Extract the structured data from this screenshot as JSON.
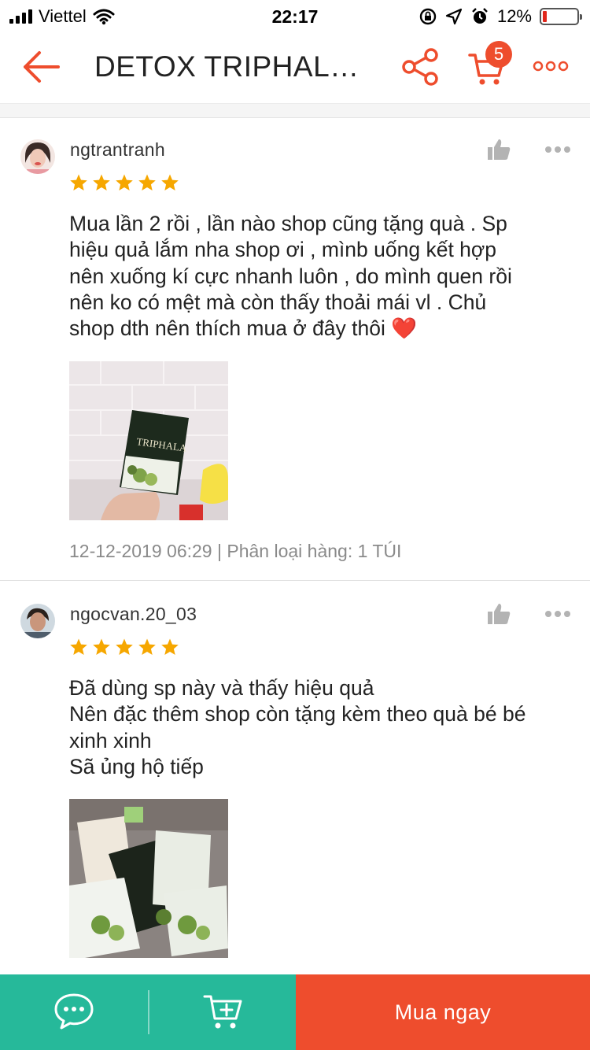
{
  "status_bar": {
    "carrier": "Viettel",
    "time": "22:17",
    "battery": "12%",
    "battery_level": 0.12
  },
  "nav": {
    "title": "DETOX TRIPHAL…",
    "cart_count": "5"
  },
  "reviews": [
    {
      "username": "ngtrantranh",
      "rating": 5,
      "text_lines": [
        "Mua lần 2 rồi , lần nào shop cũng tặng quà . Sp",
        "hiệu quả lắm nha shop ơi , mìnb uống kết hợp",
        "nên xuống kí cực nhanh luôn , do mình quen rồi",
        "nên ko có mệt mà còn thấy thoải mái vl . Chủ",
        "shop dth nên thích mua ở đây thôi ❤️"
      ],
      "meta": "12-12-2019 06:29 | Phân loại hàng: 1 TÚI"
    },
    {
      "username": "ngocvan.20_03",
      "rating": 5,
      "text_lines": [
        "Đã dùng sp này và thấy hiệu quả",
        "Nên đặc thêm shop còn tặng kèm theo quà bé bé",
        "xinh xinh",
        "Sã ủng hộ tiếp"
      ]
    }
  ],
  "bottom_bar": {
    "buy_label": "Mua ngay"
  },
  "colors": {
    "accent": "#ee4d2d",
    "star": "#f6a700",
    "chat_green": "#26b99a"
  },
  "icons": [
    "back-arrow-icon",
    "share-icon",
    "cart-icon",
    "more-icon",
    "thumbs-up-icon",
    "chat-icon",
    "add-to-cart-icon"
  ]
}
